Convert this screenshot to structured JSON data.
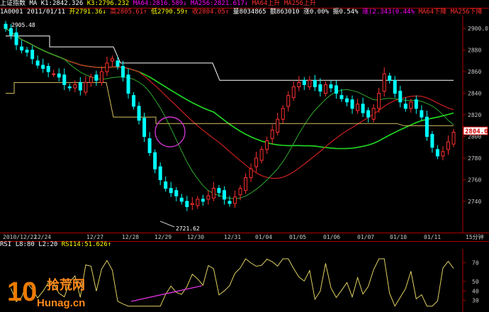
{
  "header": {
    "index_name": "上证指数",
    "ma_prefix": "MA",
    "k1": "K1:2842.326",
    "k3": "K3:2796.232",
    "ma64": "MA64:2816.589↓",
    "ma256": "MA256:2821.617↓",
    "ma64_status": "MA64上升",
    "ma256_status": "MA256上升"
  },
  "info": {
    "code_date": "1A0001  2011/01/11",
    "open": "开2791.36↓",
    "high": "高2805.61↑",
    "low": "低2790.59↑",
    "close": "收2804.05↑",
    "volume": "量8034865",
    "amount": "额863010",
    "change": "涨0.00%",
    "amp": "振0.54%",
    "rise": "涨(2.343(0.44%",
    "ma64_down": "MA64下降",
    "ma256_down": "MA256下降"
  },
  "annotations": {
    "high_label": "2905.48",
    "low_label": "2721.62",
    "last_price": "2804.0"
  },
  "axes": {
    "price_ticks": [
      "2900.0",
      "2880",
      "2860",
      "2840",
      "2820",
      "2800",
      "2780",
      "2760",
      "2740"
    ],
    "date_labels": [
      "2010/12/22",
      "12/24",
      "12/27",
      "12/28",
      "12/29",
      "12/30",
      "12/31",
      "01/04",
      "01/05",
      "01/06",
      "01/07",
      "01/10",
      "01/11"
    ],
    "period": "15分钟",
    "rsi_ticks": [
      "70",
      "50",
      "40",
      "30"
    ]
  },
  "rsi": {
    "title": "RSI",
    "l": "L8:80",
    "l2": "L2:20",
    "value": "RSI14:51.626↑"
  },
  "watermark": {
    "number": "10",
    "cn": "拾荒网",
    "domain": "Hunag.cn"
  },
  "colors": {
    "background": "#000000",
    "up_candle": "#ff3030",
    "down_candle": "#00ffff",
    "ma_green": "#22dd22",
    "ma_red": "#cc2020",
    "ma_white": "#ffffff",
    "ma_yellow": "#d8c060",
    "rsi_line": "#e0d060",
    "divider": "#b00000"
  },
  "chart_data": {
    "type": "candlestick",
    "y_range": [
      2715,
      2908
    ],
    "series_closes": [
      2900,
      2894,
      2885,
      2880,
      2878,
      2872,
      2866,
      2863,
      2860,
      2858,
      2855,
      2848,
      2845,
      2848,
      2843,
      2850,
      2855,
      2852,
      2860,
      2868,
      2872,
      2865,
      2855,
      2840,
      2828,
      2815,
      2800,
      2785,
      2770,
      2760,
      2752,
      2748,
      2745,
      2740,
      2735,
      2738,
      2742,
      2740,
      2745,
      2752,
      2748,
      2742,
      2738,
      2744,
      2752,
      2762,
      2770,
      2780,
      2788,
      2796,
      2806,
      2816,
      2826,
      2838,
      2846,
      2850,
      2848,
      2852,
      2846,
      2842,
      2848,
      2845,
      2840,
      2835,
      2832,
      2826,
      2830,
      2822,
      2818,
      2826,
      2840,
      2858,
      2852,
      2840,
      2832,
      2826,
      2832,
      2826,
      2818,
      2800,
      2790,
      2782,
      2786,
      2795,
      2804
    ]
  }
}
